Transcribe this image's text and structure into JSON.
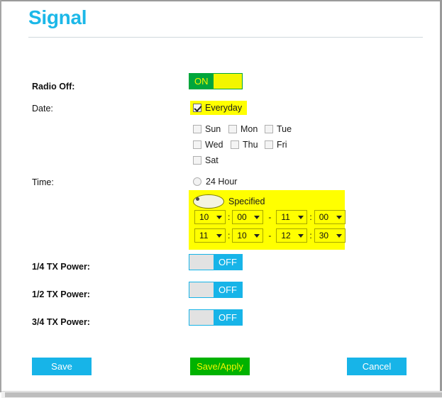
{
  "page": {
    "title": "Signal"
  },
  "rows": {
    "radio_off": {
      "label": "Radio Off:",
      "toggle_state": "ON"
    },
    "date": {
      "label": "Date:",
      "everyday_label": "Everyday",
      "everyday_checked": true,
      "days": [
        {
          "label": "Sun",
          "checked": false
        },
        {
          "label": "Mon",
          "checked": false
        },
        {
          "label": "Tue",
          "checked": false
        },
        {
          "label": "Wed",
          "checked": false
        },
        {
          "label": "Thu",
          "checked": false
        },
        {
          "label": "Fri",
          "checked": false
        },
        {
          "label": "Sat",
          "checked": false
        }
      ]
    },
    "time": {
      "label": "Time:",
      "mode_24h_label": "24 Hour",
      "mode_24h_selected": false,
      "mode_specified_label": "Specified",
      "mode_specified_selected": true,
      "ranges": [
        {
          "start_hour": "10",
          "start_minute": "00",
          "separator": "-",
          "end_hour": "11",
          "end_minute": "00"
        },
        {
          "start_hour": "11",
          "start_minute": "10",
          "separator": "-",
          "end_hour": "12",
          "end_minute": "30"
        }
      ],
      "colon": ":"
    },
    "tx_power": [
      {
        "label": "1/4 TX Power:",
        "toggle_state": "OFF"
      },
      {
        "label": "1/2 TX Power:",
        "toggle_state": "OFF"
      },
      {
        "label": "3/4 TX Power:",
        "toggle_state": "OFF"
      }
    ]
  },
  "buttons": {
    "save": "Save",
    "save_apply": "Save/Apply",
    "cancel": "Cancel"
  },
  "colors": {
    "accent_cyan": "#17b4e8",
    "title_blue": "#1cb8e8",
    "toggle_on_green": "#00a63c",
    "toggle_on_knob_yellow": "#f2f600",
    "toggle_off_blue": "#17b4e8",
    "toggle_off_knob_gray": "#e2e2e2",
    "highlight_yellow": "#ffff00",
    "apply_green": "#00b200"
  }
}
